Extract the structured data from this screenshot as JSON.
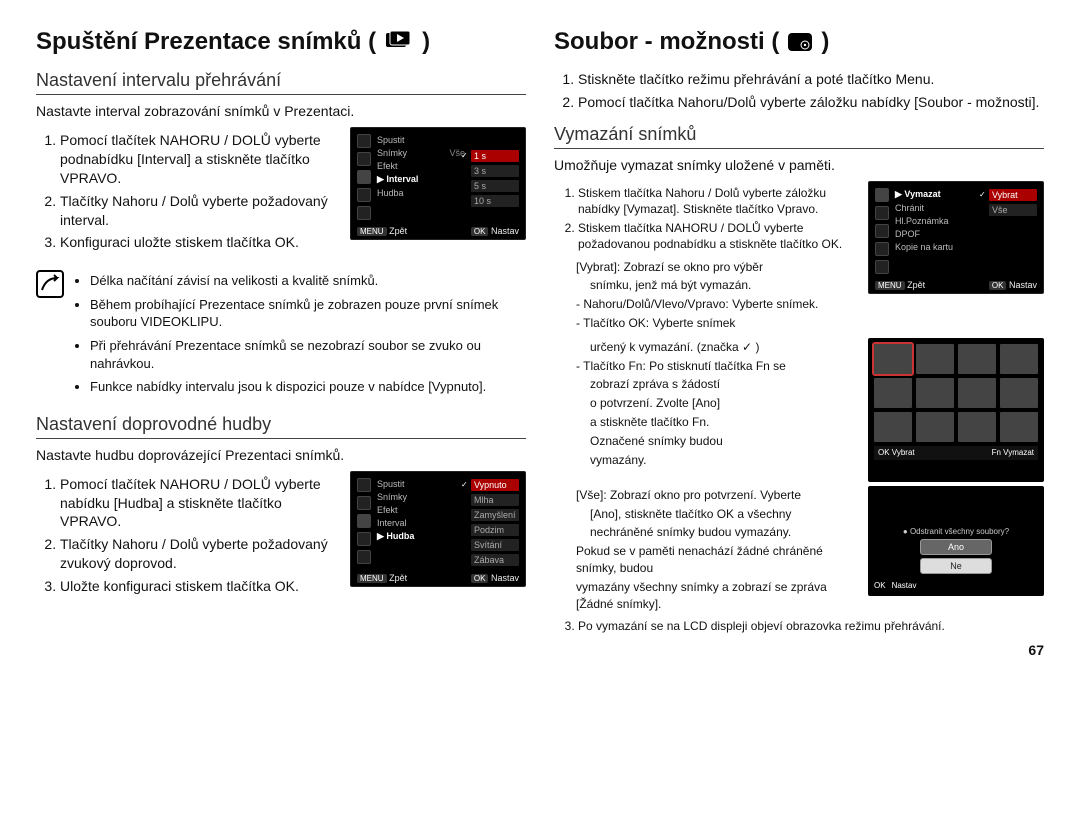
{
  "page_number": "67",
  "left": {
    "title": "Spuštění Prezentace snímků (",
    "title_close": ")",
    "icon": "slideshow-play-icon",
    "sec1": {
      "heading": "Nastavení intervalu přehrávání",
      "lead": "Nastavte interval zobrazování snímků v Prezentaci.",
      "steps": [
        "Pomocí tlačítek NAHORU / DOLŮ vyberte podnabídku [Interval] a stiskněte tlačítko VPRAVO.",
        "Tlačítky Nahoru / Dolů vyberte požadovaný interval.",
        "Konfiguraci uložte stiskem tlačítka OK."
      ]
    },
    "lcd1": {
      "menu": [
        "Spustit",
        "Snímky",
        "Efekt",
        "Interval",
        "Hudba"
      ],
      "selected_menu": "Interval",
      "right_label": "Vše",
      "options": [
        "1 s",
        "3 s",
        "5 s",
        "10 s"
      ],
      "selected_option": "1 s",
      "bar_left_key": "MENU",
      "bar_left": "Zpět",
      "bar_right_key": "OK",
      "bar_right": "Nastav"
    },
    "notes": [
      "Délka načítání závisí na velikosti a kvalitě snímků.",
      "Během probíhající Prezentace snímků je zobrazen pouze první snímek souboru VIDEOKLIPU.",
      "Při přehrávání Prezentace snímků se nezobrazí soubor se zvuko ou nahrávkou.",
      "Funkce nabídky intervalu jsou k dispozici pouze v nabídce [Vypnuto]."
    ],
    "sec2": {
      "heading": "Nastavení doprovodné hudby",
      "lead": "Nastavte hudbu doprovázející Prezentaci snímků.",
      "steps": [
        "Pomocí tlačítek NAHORU / DOLŮ vyberte nabídku [Hudba] a stiskněte tlačítko VPRAVO.",
        "Tlačítky Nahoru / Dolů vyberte požadovaný zvukový doprovod.",
        "Uložte konfiguraci stiskem tlačítka OK."
      ]
    },
    "lcd2": {
      "menu": [
        "Spustit",
        "Snímky",
        "Efekt",
        "Interval",
        "Hudba"
      ],
      "selected_menu": "Hudba",
      "options": [
        "Vypnuto",
        "Mlha",
        "Zamyšlení",
        "Podzim",
        "Svítání",
        "Zábava"
      ],
      "selected_option": "Vypnuto",
      "bar_left_key": "MENU",
      "bar_left": "Zpět",
      "bar_right_key": "OK",
      "bar_right": "Nastav"
    }
  },
  "right": {
    "title": "Soubor - možnosti (",
    "title_close": ")",
    "icon": "file-gear-icon",
    "intro_steps": [
      "Stiskněte tlačítko režimu přehrávání a poté tlačítko Menu.",
      "Pomocí tlačítka Nahoru/Dolů vyberte záložku nabídky [Soubor - možnosti]."
    ],
    "sec": {
      "heading": "Vymazání snímků",
      "lead": "Umožňuje vymazat snímky uložené v paměti.",
      "steps": [
        "Stiskem tlačítka Nahoru / Dolů vyberte záložku nabídky [Vymazat]. Stiskněte tlačítko Vpravo.",
        "Stiskem tlačítka NAHORU / DOLŮ vyberte požadovanou podnabídku a stiskněte tlačítko OK."
      ],
      "vybrat_lbl": "[Vybrat]: Zobrazí se okno pro výběr",
      "vybrat_l1": "snímku, jenž má být vymazán.",
      "vybrat_nav": "- Nahoru/Dolů/Vlevo/Vpravo: Vyberte snímek.",
      "vybrat_ok": "- Tlačítko OK: Vyberte snímek",
      "vybrat_mark": "určený k vymazání. (značka ✓ )",
      "vybrat_fn1": "- Tlačítko Fn: Po stisknutí  tlačítka Fn se",
      "vybrat_fn2": "zobrazí zpráva s žádostí",
      "vybrat_fn3": "o potvrzení. Zvolte [Ano]",
      "vybrat_fn4": "a stiskněte tlačítko Fn.",
      "vybrat_fn5": "Označené snímky budou",
      "vybrat_fn6": "vymazány.",
      "vse_lbl": "[Vše]: Zobrazí okno pro potvrzení. Vyberte",
      "vse_l1": "[Ano], stiskněte tlačítko OK a všechny",
      "vse_l2": "nechráněné snímky budou vymazány.",
      "tail1": "Pokud se v paměti nenachází žádné chráněné snímky, budou",
      "tail2": "vymazány všechny snímky a zobrazí se zpráva [Žádné snímky].",
      "step3": "Po vymazání se na LCD displeji objeví obrazovka režimu přehrávání."
    },
    "lcd1": {
      "menu": [
        "Vymazat",
        "Chránit",
        "Hl.Poznámka",
        "DPOF",
        "Kopie na kartu"
      ],
      "selected_menu": "Vymazat",
      "options": [
        "Vybrat",
        "Vše"
      ],
      "selected_option": "Vybrat",
      "bar_left_key": "MENU",
      "bar_left": "Zpět",
      "bar_right_key": "OK",
      "bar_right": "Nastav"
    },
    "thumbs": {
      "bar_left_key": "OK",
      "bar_left": "Vybrat",
      "bar_right_key": "Fn",
      "bar_right": "Vymazat"
    },
    "dlg": {
      "title": "● Odstranit všechny soubory?",
      "yes": "Ano",
      "no": "Ne",
      "bar_key": "OK",
      "bar": "Nastav"
    }
  }
}
